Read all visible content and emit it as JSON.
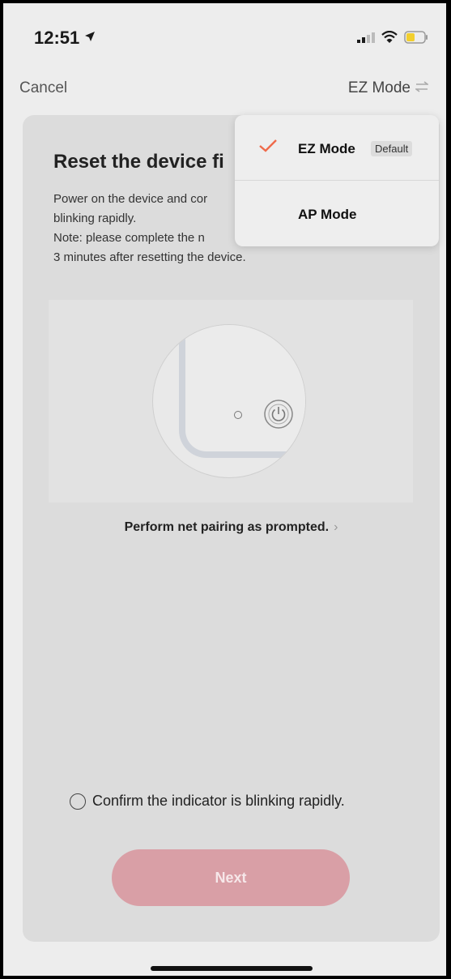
{
  "status_bar": {
    "time": "12:51"
  },
  "nav": {
    "cancel_label": "Cancel",
    "mode_label": "EZ Mode"
  },
  "card": {
    "title": "Reset the device fi",
    "desc_line1": "Power on the device and cor",
    "desc_line2": "blinking rapidly.",
    "desc_line3": "Note: please complete the n",
    "desc_line4": "3 minutes after resetting the device.",
    "pairing_link": "Perform net pairing as prompted.",
    "confirm_label": "Confirm the indicator is blinking rapidly.",
    "next_label": "Next"
  },
  "menu": {
    "items": [
      {
        "label": "EZ Mode",
        "badge": "Default",
        "selected": true
      },
      {
        "label": "AP Mode",
        "selected": false
      }
    ]
  },
  "colors": {
    "accent": "#ef6a4a",
    "next_button": "#d99fa6"
  }
}
